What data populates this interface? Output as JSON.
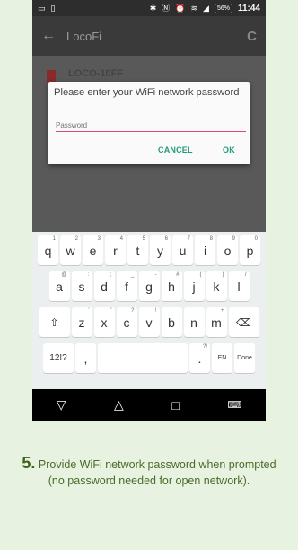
{
  "statusbar": {
    "battery": "56%",
    "time": "11:44",
    "icons": [
      "screen-icon",
      "sim-icon",
      "bluetooth-icon",
      "nfc-icon",
      "alarm-icon",
      "wifi-icon",
      "signal-icon"
    ]
  },
  "appbar": {
    "title": "LocoFi",
    "back_icon": "arrow-back-icon",
    "refresh_icon": "refresh-icon"
  },
  "background_list": {
    "item_text": "LOCO-10FF"
  },
  "dialog": {
    "message": "Please enter your WiFi network password",
    "password_placeholder": "Password",
    "cancel_label": "CANCEL",
    "ok_label": "OK",
    "accent_color": "#e0457b",
    "button_color": "#1e9b7c"
  },
  "keyboard": {
    "row1": [
      {
        "k": "q",
        "h": "1"
      },
      {
        "k": "w",
        "h": "2"
      },
      {
        "k": "e",
        "h": "3"
      },
      {
        "k": "r",
        "h": "4"
      },
      {
        "k": "t",
        "h": "5"
      },
      {
        "k": "y",
        "h": "6"
      },
      {
        "k": "u",
        "h": "7"
      },
      {
        "k": "i",
        "h": "8"
      },
      {
        "k": "o",
        "h": "9"
      },
      {
        "k": "p",
        "h": "0"
      }
    ],
    "row2": [
      {
        "k": "a",
        "h": "@"
      },
      {
        "k": "s",
        "h": ":"
      },
      {
        "k": "d",
        "h": ";"
      },
      {
        "k": "f",
        "h": "_"
      },
      {
        "k": "g",
        "h": "-"
      },
      {
        "k": "h",
        "h": "#"
      },
      {
        "k": "j",
        "h": "("
      },
      {
        "k": "k",
        "h": ")"
      },
      {
        "k": "l",
        "h": "/"
      }
    ],
    "row3": [
      {
        "k": "z",
        "h": "'"
      },
      {
        "k": "x",
        "h": "\""
      },
      {
        "k": "c",
        "h": "?"
      },
      {
        "k": "v",
        "h": "!"
      },
      {
        "k": "b",
        "h": ""
      },
      {
        "k": "n",
        "h": ""
      },
      {
        "k": "m",
        "h": "+"
      }
    ],
    "symbols_label": "12!?",
    "comma": ",",
    "period": ".",
    "period_hint": "?!",
    "lang_label": "EN",
    "done_label": "Done",
    "shift_glyph": "⇧",
    "delete_glyph": "⌫"
  },
  "navbar": {
    "back_glyph": "▽",
    "home_glyph": "△",
    "recents_glyph": "□",
    "keyboard_glyph": "⌨"
  },
  "caption": {
    "step_number": "5.",
    "text": "Provide WiFi network password when prompted (no password needed for open network)."
  }
}
